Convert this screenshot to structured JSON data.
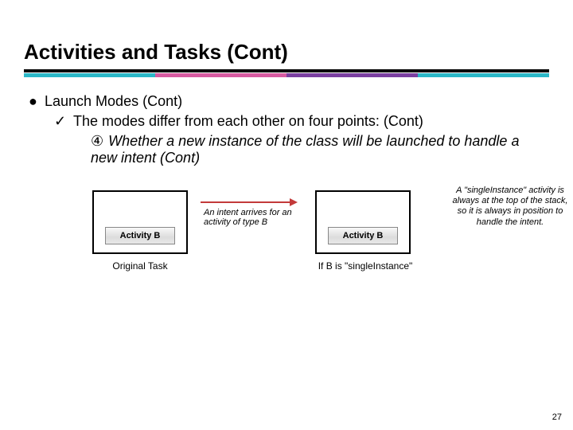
{
  "title": "Activities and Tasks (Cont)",
  "l1_text": "Launch Modes (Cont)",
  "l2_text": "The modes differ from each other on four points: (Cont)",
  "l3_num": "④",
  "l3_text": "Whether a new instance of the class will be launched to handle a new intent (Cont)",
  "activity_label": "Activity B",
  "caption_one": "Original Task",
  "caption_two": "If B is \"singleInstance\"",
  "intent_label": "An intent arrives for an activity of type B",
  "side_note": "A \"singleInstance\" activity is always at the top of the stack, so it is always in position to handle the intent.",
  "page_number": "27"
}
